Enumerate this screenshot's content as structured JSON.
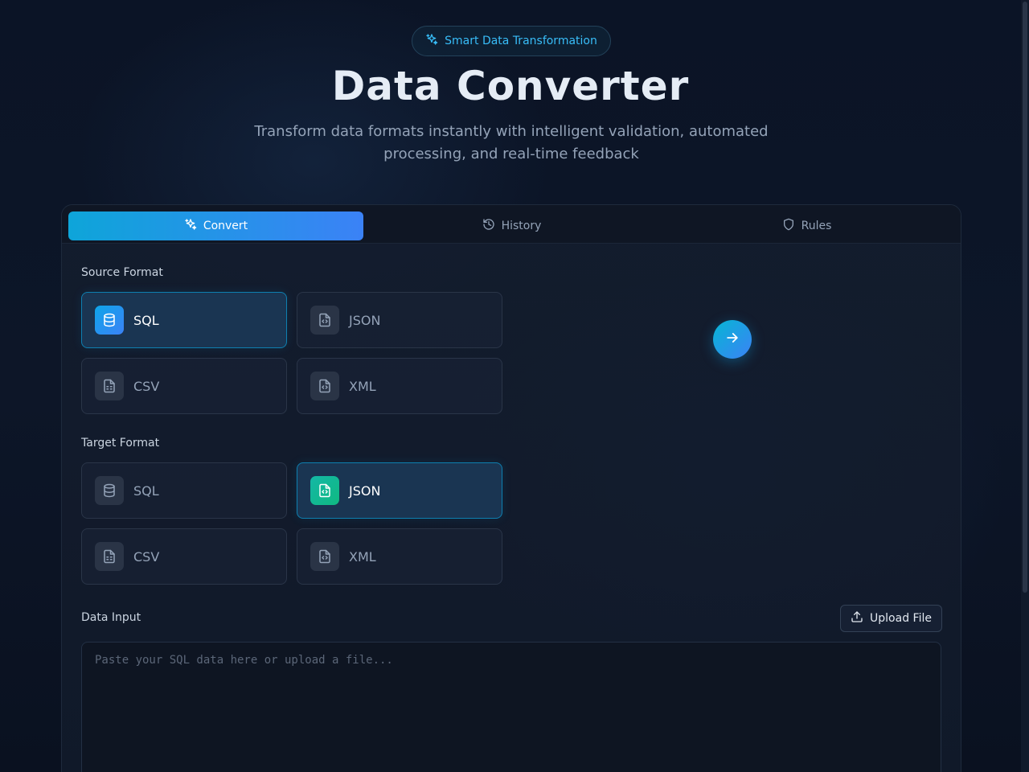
{
  "header": {
    "badge": "Smart Data Transformation",
    "title": "Data Converter",
    "subtitle": "Transform data formats instantly with intelligent validation, automated processing, and real-time feedback"
  },
  "tabs": [
    {
      "label": "Convert",
      "icon": "sparkles-icon",
      "active": true
    },
    {
      "label": "History",
      "icon": "history-icon",
      "active": false
    },
    {
      "label": "Rules",
      "icon": "shield-icon",
      "active": false
    }
  ],
  "source": {
    "label": "Source Format",
    "formats": [
      {
        "label": "SQL",
        "icon": "database-icon",
        "selected": true
      },
      {
        "label": "JSON",
        "icon": "file-code-icon",
        "selected": false
      },
      {
        "label": "CSV",
        "icon": "file-spreadsheet-icon",
        "selected": false
      },
      {
        "label": "XML",
        "icon": "file-code-icon",
        "selected": false
      }
    ]
  },
  "target": {
    "label": "Target Format",
    "formats": [
      {
        "label": "SQL",
        "icon": "database-icon",
        "selected": false
      },
      {
        "label": "JSON",
        "icon": "file-code-icon",
        "selected": true
      },
      {
        "label": "CSV",
        "icon": "file-spreadsheet-icon",
        "selected": false
      },
      {
        "label": "XML",
        "icon": "file-code-icon",
        "selected": false
      }
    ]
  },
  "input": {
    "label": "Data Input",
    "upload_label": "Upload File",
    "placeholder": "Paste your SQL data here or upload a file...",
    "value": ""
  },
  "colors": {
    "accent": "#0ea5e9",
    "accent2": "#3b82f6",
    "teal": "#14b8a6",
    "background": "#0b1324"
  }
}
